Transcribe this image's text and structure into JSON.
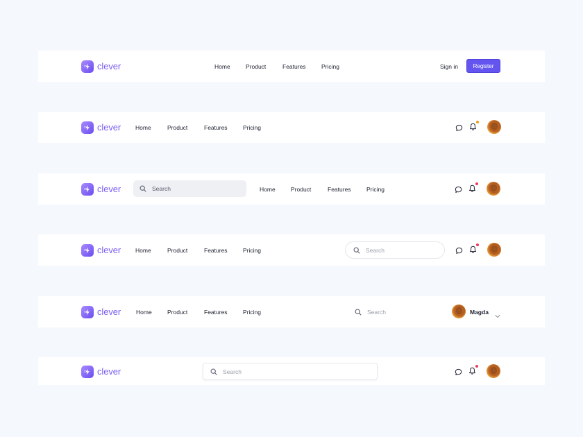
{
  "brand": {
    "name": "clever"
  },
  "nav": [
    "Home",
    "Product",
    "Features",
    "Pricing"
  ],
  "auth": {
    "sign_in": "Sign in",
    "register": "Register"
  },
  "search": {
    "placeholder": "Search"
  },
  "user": {
    "name": "Magda"
  },
  "colors": {
    "background": "#f5f8fc",
    "brand": "#7a5cf2",
    "register_button": "#6455f0",
    "notification_dot_orange": "#f29a1f",
    "notification_dot_red": "#ef3b5a"
  },
  "icons": [
    "bolt-icon",
    "search-icon",
    "chat-icon",
    "bell-icon",
    "chevron-down-icon"
  ]
}
